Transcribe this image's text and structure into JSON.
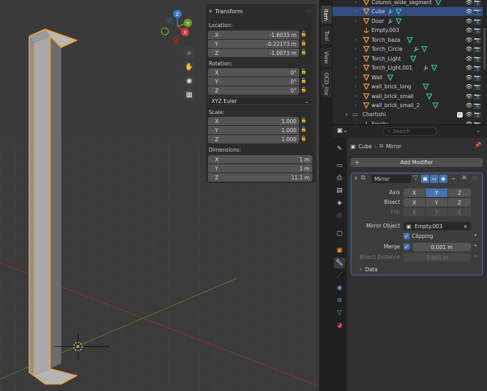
{
  "viewport": {
    "gizmo": {
      "x_label": "X",
      "y_label": "Y",
      "z_label": "Z"
    },
    "nav_buttons": [
      "zoom-icon",
      "hand-icon",
      "camera-icon",
      "grid-icon"
    ]
  },
  "npanel": {
    "title": "Transform",
    "location_label": "Location:",
    "location": [
      {
        "axis": "X",
        "value": "-1.6033 m"
      },
      {
        "axis": "Y",
        "value": "-0.22173 m"
      },
      {
        "axis": "Z",
        "value": "-1.0073 m"
      }
    ],
    "rotation_label": "Rotation:",
    "rotation": [
      {
        "axis": "X",
        "value": "0°"
      },
      {
        "axis": "Y",
        "value": "0°"
      },
      {
        "axis": "Z",
        "value": "0°"
      }
    ],
    "rotation_mode": "XYZ Euler",
    "scale_label": "Scale:",
    "scale": [
      {
        "axis": "X",
        "value": "1.000"
      },
      {
        "axis": "Y",
        "value": "1.000"
      },
      {
        "axis": "Z",
        "value": "1.000"
      }
    ],
    "dimensions_label": "Dimensions:",
    "dimensions": [
      {
        "axis": "X",
        "value": "1 m"
      },
      {
        "axis": "Y",
        "value": "1 m"
      },
      {
        "axis": "Z",
        "value": "11.1 m"
      }
    ]
  },
  "side_tabs": [
    "Item",
    "Tool",
    "View",
    "OCD_lite"
  ],
  "outliner": {
    "rows": [
      {
        "name": "Column_wide_segment",
        "type": "mesh",
        "mods": [
          "filter"
        ],
        "selected": false
      },
      {
        "name": "Cube",
        "type": "mesh",
        "mods": [
          "wrench",
          "filter"
        ],
        "selected": true
      },
      {
        "name": "Door",
        "type": "mesh",
        "mods": [
          "wrench",
          "filter"
        ],
        "selected": false
      },
      {
        "name": "Empty.003",
        "type": "empty",
        "mods": [],
        "selected": false
      },
      {
        "name": "Torch_baza",
        "type": "mesh",
        "mods": [
          "filter"
        ],
        "selected": false
      },
      {
        "name": "Torch_Circle",
        "type": "mesh",
        "mods": [
          "wrench",
          "filter"
        ],
        "selected": false
      },
      {
        "name": "Torch_Light",
        "type": "mesh",
        "mods": [
          "filter"
        ],
        "selected": false
      },
      {
        "name": "Torch_Light.001",
        "type": "mesh",
        "mods": [
          "wrench",
          "filter"
        ],
        "selected": false
      },
      {
        "name": "Wall",
        "type": "mesh",
        "mods": [
          "filter"
        ],
        "selected": false
      },
      {
        "name": "wall_brick_long",
        "type": "mesh",
        "mods": [
          "filter"
        ],
        "selected": false
      },
      {
        "name": "wall_brick_small",
        "type": "mesh",
        "mods": [
          "filter"
        ],
        "selected": false
      },
      {
        "name": "wall_brick_small_2",
        "type": "mesh",
        "mods": [
          "filter"
        ],
        "selected": false
      }
    ],
    "collection": "Chertishi",
    "partial_row": "Empty"
  },
  "properties": {
    "search_placeholder": "Search",
    "breadcrumb_object": "Cube",
    "breadcrumb_modifier": "Mirror",
    "add_modifier": "Add Modifier",
    "modifier": {
      "name": "Mirror",
      "axis_label": "Axis",
      "bisect_label": "Bisect",
      "flip_label": "Flip",
      "axes": [
        "X",
        "Y",
        "Z"
      ],
      "axis_active": "Y",
      "mirror_object_label": "Mirror Object",
      "mirror_object": "Empty.003",
      "clipping_label": "Clipping",
      "merge_label": "Merge",
      "merge_value": "0.001 m",
      "bisect_distance_label": "Bisect Distance",
      "bisect_distance_value": "0.001 m",
      "data_label": "Data"
    }
  },
  "colors": {
    "selection": "#334d80",
    "accent": "#4772b3",
    "object_orange": "#f29f38",
    "x_axis": "#cc3a3a",
    "y_axis": "#6a9a2a",
    "z_axis": "#3a7ac8"
  }
}
